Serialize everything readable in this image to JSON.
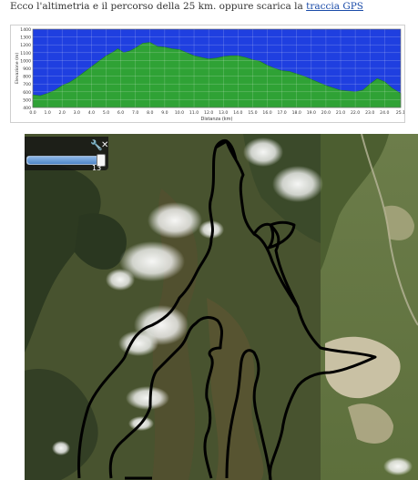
{
  "intro": {
    "text": "Ecco l'altimetria e il percorso della 25 km. oppure scarica la",
    "link": "traccia GPS"
  },
  "chart_data": {
    "type": "area",
    "xlabel": "Distanza (km)",
    "ylabel": "Elevazione (m)",
    "xlim": [
      0,
      25.1
    ],
    "ylim": [
      400,
      1400
    ],
    "x_ticks": [
      "0.0",
      "1.0",
      "2.0",
      "3.0",
      "4.0",
      "5.0",
      "6.0",
      "7.0",
      "8.0",
      "9.0",
      "10.0",
      "11.0",
      "12.0",
      "13.0",
      "14.0",
      "15.0",
      "16.0",
      "17.0",
      "18.0",
      "19.0",
      "20.0",
      "21.0",
      "22.0",
      "23.0",
      "24.0",
      "25.1"
    ],
    "y_ticks": [
      "400",
      "500",
      "600",
      "700",
      "800",
      "900",
      "1000",
      "1100",
      "1200",
      "1300",
      "1400"
    ],
    "grid": true,
    "colors": {
      "fill": "#2fa235",
      "sky": "#1f3fe0"
    },
    "series": [
      {
        "x": [
          0,
          0.5,
          1.0,
          1.5,
          2.0,
          2.5,
          3.0,
          3.5,
          4.0,
          4.5,
          5.0,
          5.5,
          5.8,
          6.2,
          6.6,
          7.0,
          7.5,
          8.0,
          8.5,
          9.0,
          9.5,
          10.0,
          10.5,
          11.0,
          11.5,
          12.0,
          12.5,
          13.0,
          13.5,
          14.0,
          14.5,
          15.0,
          15.5,
          16.0,
          16.5,
          17.0,
          17.5,
          18.0,
          18.5,
          19.0,
          19.5,
          20.0,
          20.5,
          21.0,
          21.5,
          22.0,
          22.5,
          23.0,
          23.5,
          24.0,
          24.5,
          25.1
        ],
        "y": [
          560,
          550,
          580,
          620,
          680,
          720,
          780,
          850,
          920,
          990,
          1060,
          1110,
          1150,
          1100,
          1120,
          1160,
          1220,
          1230,
          1180,
          1170,
          1150,
          1140,
          1100,
          1060,
          1040,
          1020,
          1030,
          1050,
          1060,
          1060,
          1040,
          1010,
          990,
          940,
          900,
          870,
          860,
          830,
          800,
          760,
          720,
          680,
          650,
          620,
          610,
          600,
          620,
          700,
          770,
          730,
          650,
          580
        ]
      }
    ]
  },
  "map": {
    "slider": {
      "value": 13
    }
  }
}
